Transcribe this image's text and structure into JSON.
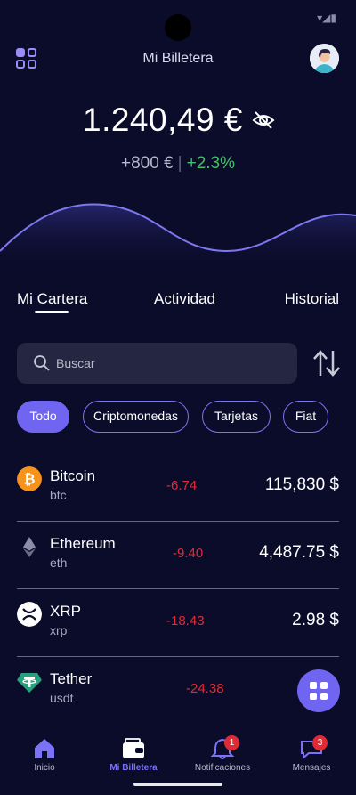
{
  "header": {
    "title": "Mi Billetera"
  },
  "balance": {
    "amount": "1.240,49 €",
    "change_abs": "+800 €",
    "separator": "|",
    "change_pct": "+2.3%"
  },
  "tabs": [
    {
      "label": "Mi Cartera",
      "active": true
    },
    {
      "label": "Actividad",
      "active": false
    },
    {
      "label": "Historial",
      "active": false
    }
  ],
  "search": {
    "placeholder": "Buscar"
  },
  "filters": [
    {
      "label": "Todo",
      "active": true
    },
    {
      "label": "Criptomonedas",
      "active": false
    },
    {
      "label": "Tarjetas",
      "active": false
    },
    {
      "label": "Fiat",
      "active": false
    }
  ],
  "assets": [
    {
      "name": "Bitcoin",
      "symbol": "btc",
      "change": "-6.74",
      "value": "115,830 $",
      "icon": "bitcoin-icon",
      "color": "#f7931a"
    },
    {
      "name": "Ethereum",
      "symbol": "eth",
      "change": "-9.40",
      "value": "4,487.75 $",
      "icon": "ethereum-icon",
      "color": "#8c8ea8"
    },
    {
      "name": "XRP",
      "symbol": "xrp",
      "change": "-18.43",
      "value": "2.98 $",
      "icon": "xrp-icon",
      "color": "#ffffff"
    },
    {
      "name": "Tether",
      "symbol": "usdt",
      "change": "-24.38",
      "value": "",
      "icon": "tether-icon",
      "color": "#26a17b"
    }
  ],
  "nav": [
    {
      "label": "Inicio",
      "icon": "home-icon",
      "active": false,
      "badge": ""
    },
    {
      "label": "Mi Billetera",
      "icon": "wallet-icon",
      "active": true,
      "badge": ""
    },
    {
      "label": "Notificaciones",
      "icon": "bell-icon",
      "active": false,
      "badge": "1"
    },
    {
      "label": "Mensajes",
      "icon": "chat-icon",
      "active": false,
      "badge": "3"
    }
  ],
  "colors": {
    "background": "#0b0c2a",
    "accent": "#7065f0",
    "positive": "#46c06b",
    "negative": "#e02b35"
  }
}
